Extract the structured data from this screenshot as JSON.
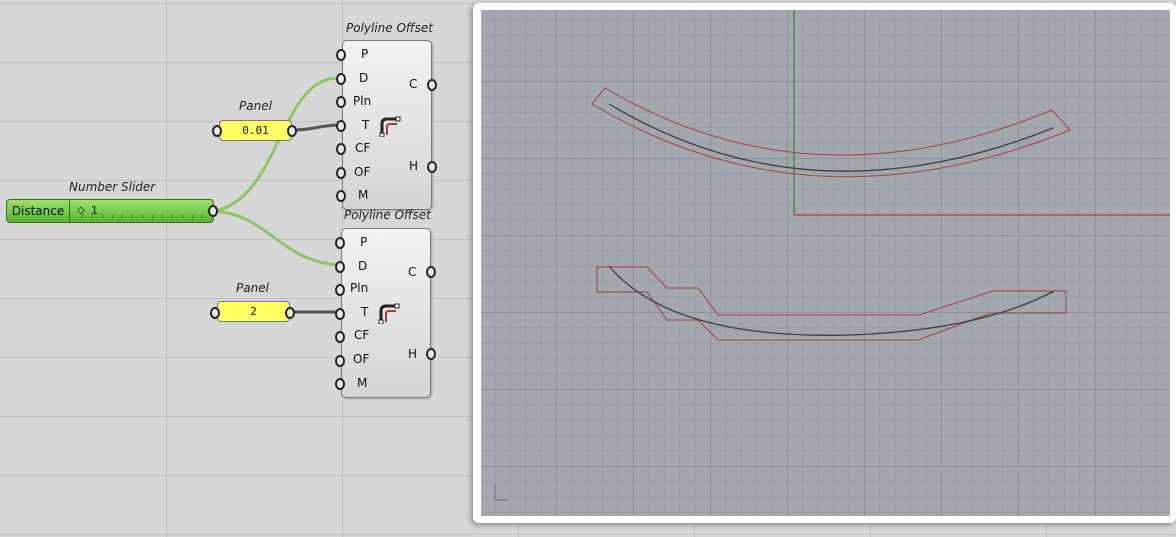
{
  "canvas": {
    "components": {
      "offset_top": {
        "title": "Polyline Offset",
        "inputs": [
          "P",
          "D",
          "Pln",
          "T",
          "CF",
          "OF",
          "M"
        ],
        "outputs": [
          "C",
          "H"
        ]
      },
      "offset_bottom": {
        "title": "Polyline Offset",
        "inputs": [
          "P",
          "D",
          "Pln",
          "T",
          "CF",
          "OF",
          "M"
        ],
        "outputs": [
          "C",
          "H"
        ]
      },
      "panel_top": {
        "title": "Panel",
        "value": "0.01"
      },
      "panel_bottom": {
        "title": "Panel",
        "value": "2"
      },
      "slider": {
        "title": "Number Slider",
        "label": "Distance",
        "value": "1"
      }
    },
    "icons": [
      "polyline-offset-icon"
    ],
    "colors": {
      "wire_active": "#8cc860",
      "wire_default": "#555555",
      "panel": "#ffff60",
      "slider": "#62c038"
    }
  },
  "viewport": {
    "icons": [
      "axis-gizmo-icon"
    ],
    "colors": {
      "curve": "#3a3f45",
      "offset_curve": "#b33a3a",
      "x_axis": "#b33a3a",
      "y_axis": "#2a8a2a"
    }
  }
}
